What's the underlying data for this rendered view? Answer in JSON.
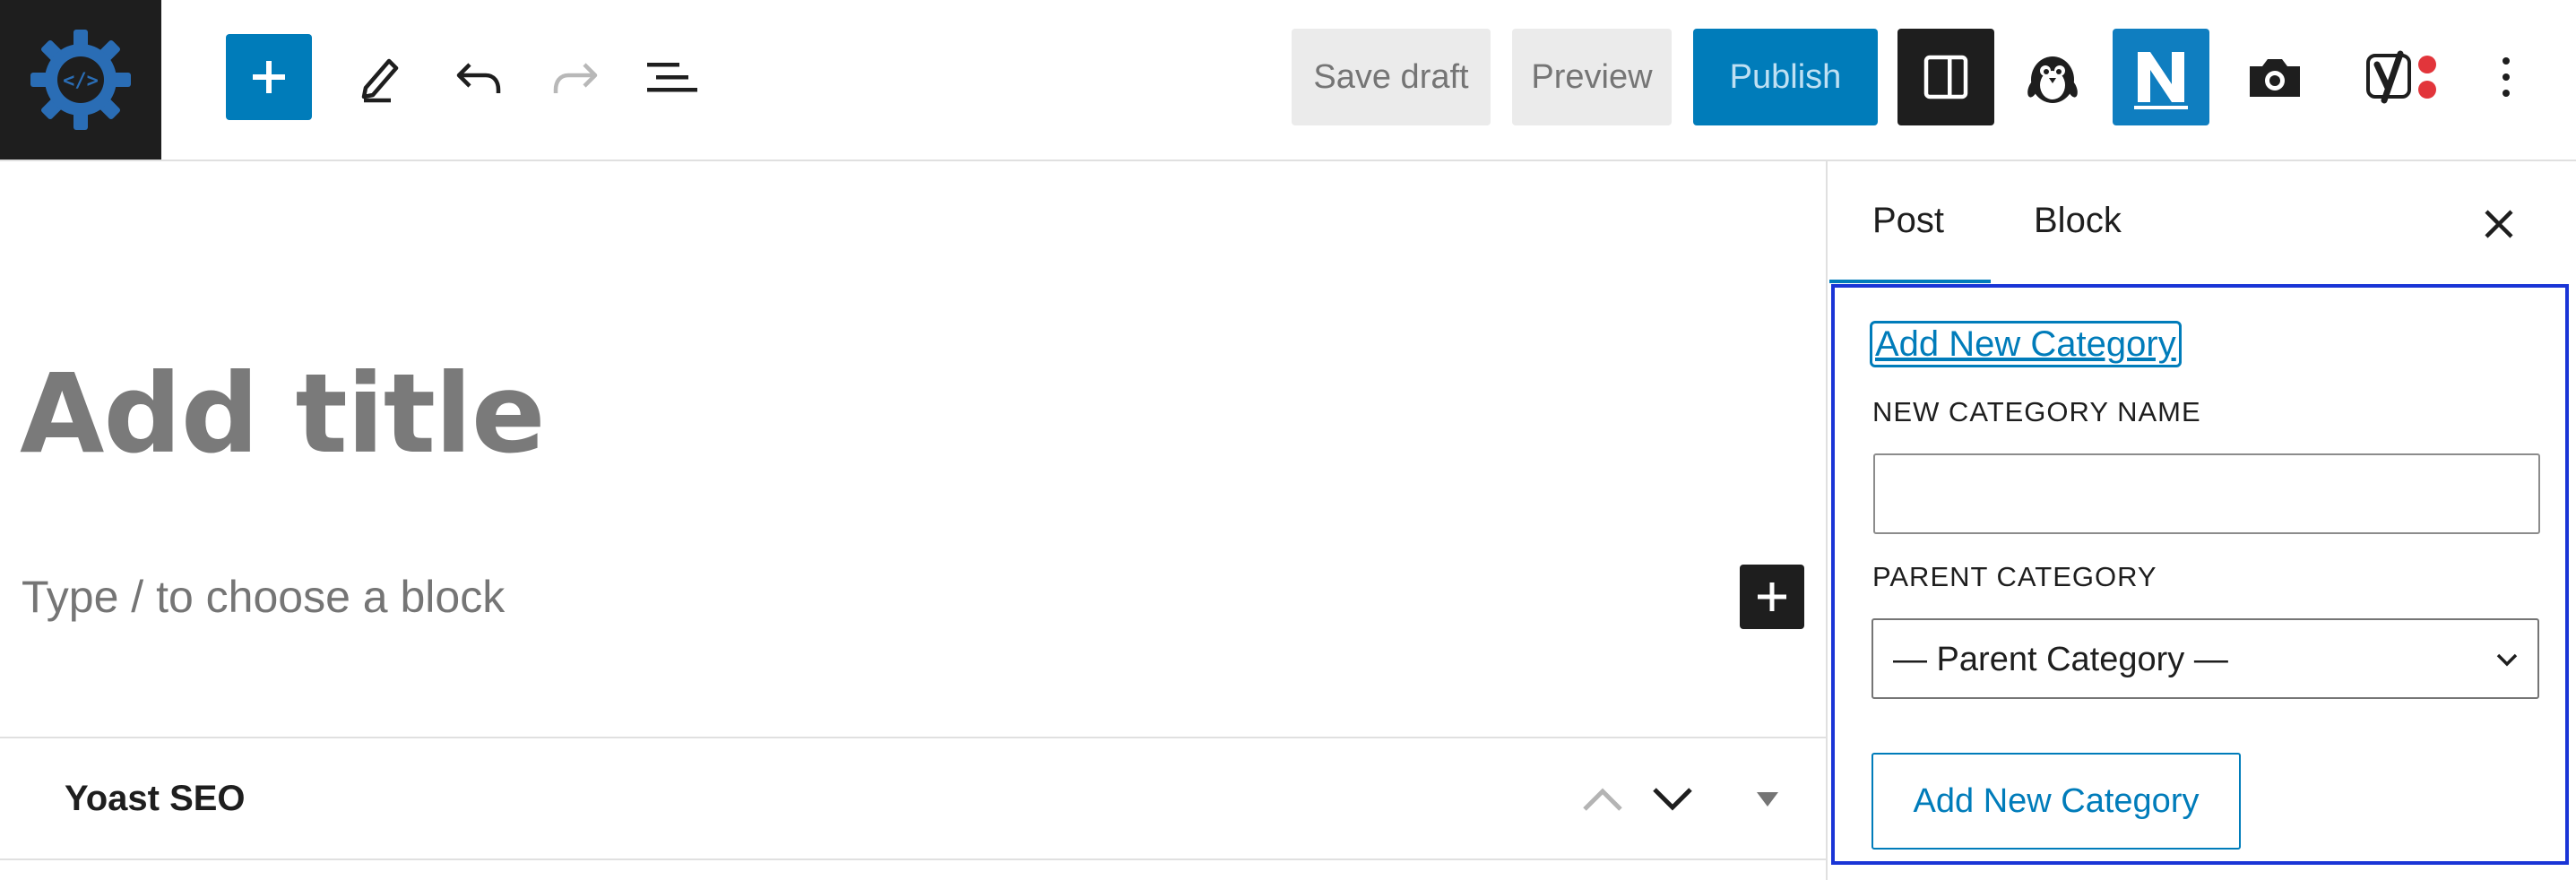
{
  "toolbar": {
    "save_draft_label": "Save draft",
    "preview_label": "Preview",
    "publish_label": "Publish",
    "icons": [
      "site-logo-icon",
      "plus-icon",
      "pencil-icon",
      "undo-icon",
      "redo-icon",
      "list-view-icon",
      "sidebar-toggle-icon",
      "penguin-icon",
      "n-logo-icon",
      "camera-icon",
      "yoast-icon",
      "more-vertical-icon"
    ]
  },
  "editor": {
    "title_placeholder": "Add title",
    "block_placeholder": "Type / to choose a block"
  },
  "metabox": {
    "title": "Yoast SEO"
  },
  "sidebar": {
    "tabs": [
      {
        "label": "Post",
        "active": true
      },
      {
        "label": "Block",
        "active": false
      }
    ],
    "add_category_link": "Add New Category",
    "new_category_label": "NEW CATEGORY NAME",
    "new_category_value": "",
    "parent_category_label": "PARENT CATEGORY",
    "parent_category_selected": "— Parent Category —",
    "add_category_button": "Add New Category"
  },
  "colors": {
    "accent": "#007cba",
    "focus_outline": "#1a35d6",
    "dark": "#1e1e1e",
    "yoast_dot": "#e2353b"
  }
}
